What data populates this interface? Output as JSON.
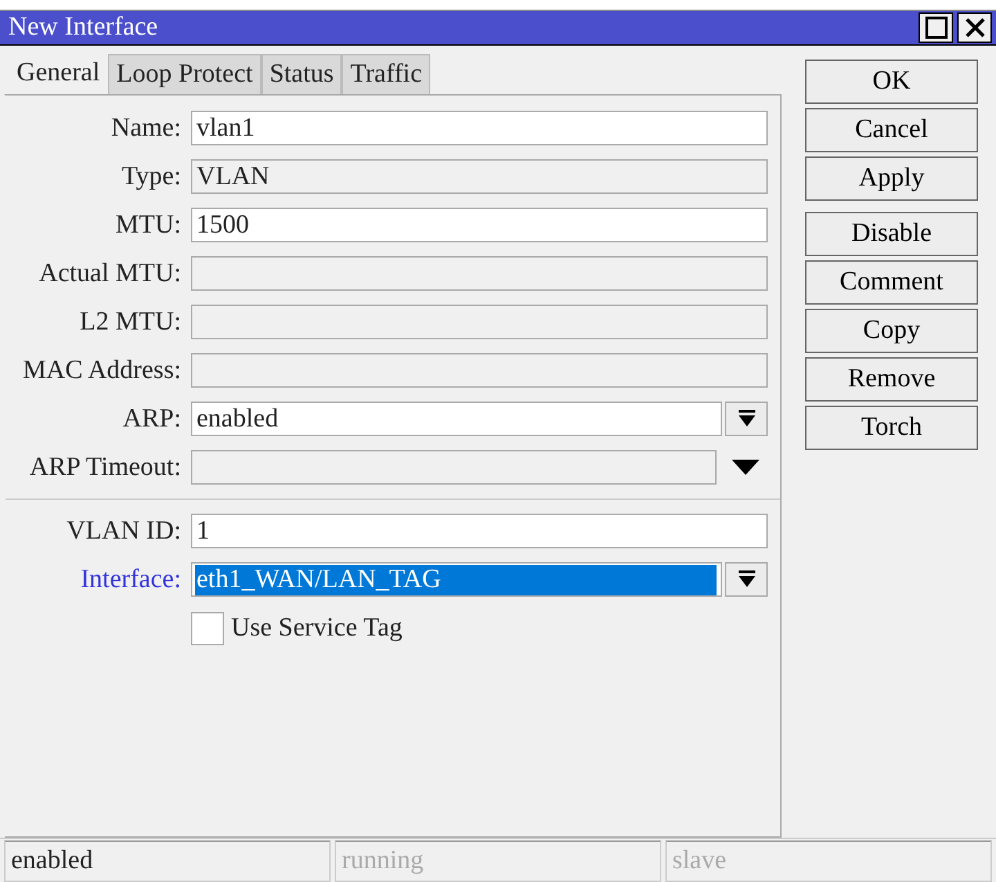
{
  "window": {
    "title": "New Interface"
  },
  "tabs": [
    {
      "label": "General",
      "selected": true
    },
    {
      "label": "Loop Protect",
      "selected": false
    },
    {
      "label": "Status",
      "selected": false
    },
    {
      "label": "Traffic",
      "selected": false
    }
  ],
  "fields": [
    {
      "kind": "text",
      "label": "Name:",
      "value": "vlan1",
      "readonly": false
    },
    {
      "kind": "text",
      "label": "Type:",
      "value": "VLAN",
      "readonly": true
    },
    {
      "kind": "text",
      "label": "MTU:",
      "value": "1500",
      "readonly": false
    },
    {
      "kind": "text",
      "label": "Actual MTU:",
      "readonly": true
    },
    {
      "kind": "text",
      "label": "L2 MTU:",
      "readonly": true
    },
    {
      "kind": "text",
      "label": "MAC Address:",
      "readonly": true
    },
    {
      "kind": "dropdown",
      "label": "ARP:",
      "value": "enabled",
      "readonly": false
    },
    {
      "kind": "expander",
      "label": "ARP Timeout:",
      "readonly": true
    },
    {
      "kind": "separator"
    },
    {
      "kind": "text",
      "label": "VLAN ID:",
      "value": "1",
      "readonly": false
    },
    {
      "kind": "dropdown",
      "label": "Interface:",
      "value": "eth1_WAN/LAN_TAG",
      "readonly": false,
      "focused": true
    },
    {
      "kind": "checkbox",
      "label": "Use Service Tag",
      "checked": false
    }
  ],
  "buttons": [
    "OK",
    "Cancel",
    "Apply",
    "Disable",
    "Comment",
    "Copy",
    "Remove",
    "Torch"
  ],
  "status_bar": [
    {
      "text": "enabled",
      "disabled": false
    },
    {
      "text": "running",
      "disabled": true
    },
    {
      "text": "slave",
      "disabled": true
    }
  ]
}
